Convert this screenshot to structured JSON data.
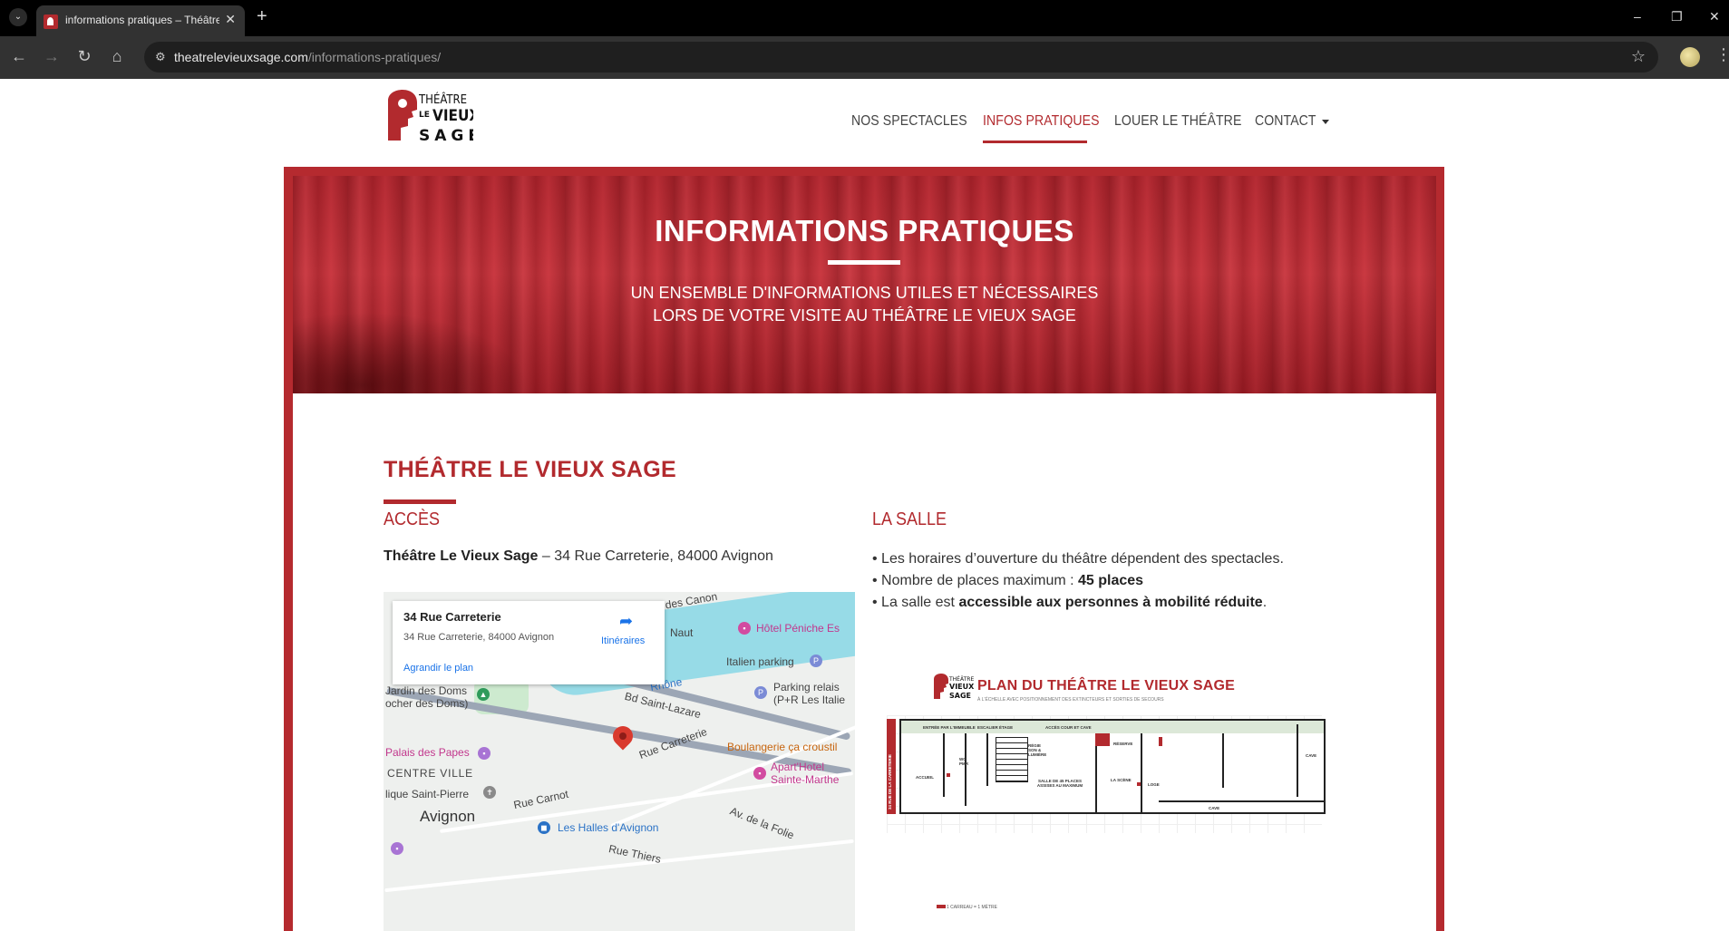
{
  "browser": {
    "tab_title": "informations pratiques – Théâtre Le Vieux Sage",
    "new_tab": "+",
    "tab_close": "✕",
    "url_host": "theatrelevieuxsage.com",
    "url_path": "/informations-pratiques/",
    "win_minimize": "–",
    "win_restore": "❐",
    "win_close": "✕"
  },
  "site": {
    "logo_text": [
      "THÉÂTRE",
      "LE",
      "VIEUX",
      "SAGE"
    ],
    "nav": [
      {
        "label": "NOS SPECTACLES"
      },
      {
        "label": "INFOS PRATIQUES",
        "active": true
      },
      {
        "label": "LOUER LE THÉÂTRE"
      },
      {
        "label": "CONTACT"
      }
    ],
    "accent_color": "#b22a2e"
  },
  "hero": {
    "title": "INFORMATIONS PRATIQUES",
    "subtitle_line1": "UN ENSEMBLE D'INFORMATIONS UTILES ET NÉCESSAIRES",
    "subtitle_line2": "LORS DE VOTRE VISITE AU THÉÂTRE LE VIEUX SAGE"
  },
  "content": {
    "section_title": "THÉÂTRE LE VIEUX SAGE",
    "acces": {
      "heading": "ACCÈS",
      "address_name": "Théâtre Le Vieux Sage",
      "address_rest": " – 34 Rue Carreterie, 84000 Avignon"
    },
    "salle": {
      "heading": "LA SALLE",
      "line1": "• Les horaires d’ouverture du théâtre dépendent des spectacles.",
      "line2_prefix": "• Nombre de places maximum : ",
      "line2_bold": "45 places",
      "line3_prefix": "• La salle est ",
      "line3_bold": "accessible aux personnes à mobilité réduite",
      "line3_suffix": "."
    }
  },
  "map": {
    "card_title": "34 Rue Carreterie",
    "card_address": "34 Rue Carreterie, 84000 Avignon",
    "card_link": "Agrandir le plan",
    "card_directions": "Itinéraires",
    "labels": {
      "chem": "Chem. des Canon",
      "naut": "Naut",
      "hotel_peniche": "Hôtel Péniche Es",
      "italien": "Italien parking",
      "jardin": "Jardin des Doms",
      "rocher": "ocher des Doms)",
      "rhone": "Rhône",
      "parking_relais": "Parking relais",
      "pr_les_italie": "(P+R Les Italie",
      "bd_saint_lazare": "Bd Saint-Lazare",
      "palais": "Palais des Papes",
      "rue_carreterie": "Rue Carreterie",
      "boulangerie": "Boulangerie ça croustil",
      "centre_ville": "CENTRE VILLE",
      "apart_hotel": "Apart'Hotel",
      "sainte_marthe": "Sainte-Marthe",
      "saint_pierre": "lique Saint-Pierre",
      "rue_carnot": "Rue Carnot",
      "avignon": "Avignon",
      "halles": "Les Halles d'Avignon",
      "av_folie": "Av. de la Folie",
      "rue_thiers": "Rue Thiers"
    }
  },
  "plan": {
    "title": "PLAN DU THÉÂTRE LE VIEUX SAGE",
    "subtitle": "À L'ÉCHELLE AVEC POSITIONNEMENT DES EXTINCTEURS ET SORTIES DE SECOURS",
    "labels": {
      "entree": "ENTRÉE PAR L'IMMEUBLE",
      "escalier": "ESCALIER ÉTAGE",
      "acces_cour": "ACCÈS COUR ET CAVE",
      "reserve": "RÉSERVE",
      "regie": "RÉGIE SON & LUMIÈRE",
      "accueil": "ACCUEIL",
      "wc": "WC PMR",
      "salle": "SALLE DE 45 PLACES ASSISES AU MAXIMUM",
      "scene": "LA SCÈNE",
      "loge": "LOGE",
      "cave1": "CAVE",
      "cave2": "CAVE",
      "street": "34 RUE DE LA CARRETERIE",
      "scale": "1 CARREAU = 1 MÈTRE"
    }
  }
}
